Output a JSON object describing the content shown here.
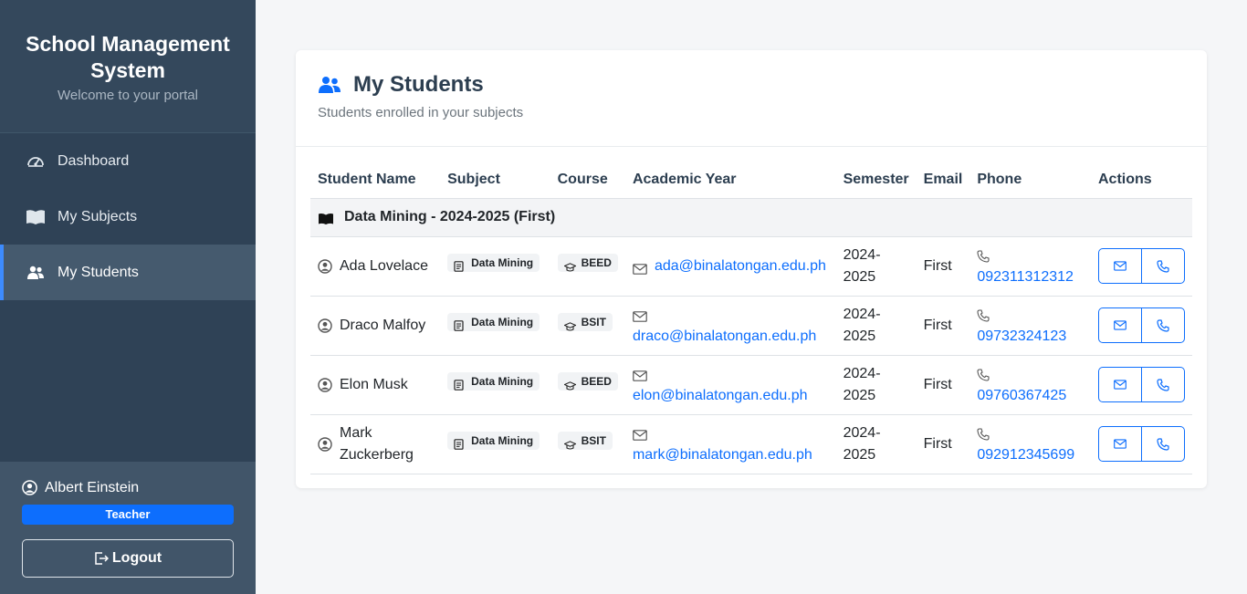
{
  "sidebar": {
    "title": "School Management System",
    "subtitle": "Welcome to your portal",
    "items": [
      {
        "label": "Dashboard",
        "icon": "speedometer-icon",
        "active": false
      },
      {
        "label": "My Subjects",
        "icon": "book-icon",
        "active": false
      },
      {
        "label": "My Students",
        "icon": "people-icon",
        "active": true
      }
    ],
    "user": {
      "name": "Albert Einstein",
      "role": "Teacher",
      "logout_label": "Logout"
    }
  },
  "main": {
    "title": "My Students",
    "subtitle": "Students enrolled in your subjects",
    "columns": [
      "Student Name",
      "Subject",
      "Course",
      "Academic Year",
      "Semester",
      "Email",
      "Phone",
      "Actions"
    ],
    "group_label": "Data Mining - 2024-2025 (First)",
    "rows": [
      {
        "name": "Ada Lovelace",
        "subject": "Data Mining",
        "course": "BEED",
        "email": "ada@binalatongan.edu.ph",
        "year": "2024-2025",
        "semester": "First",
        "phone": "092311312312"
      },
      {
        "name": "Draco Malfoy",
        "subject": "Data Mining",
        "course": "BSIT",
        "email": "draco@binalatongan.edu.ph",
        "year": "2024-2025",
        "semester": "First",
        "phone": "09732324123"
      },
      {
        "name": "Elon Musk",
        "subject": "Data Mining",
        "course": "BEED",
        "email": "elon@binalatongan.edu.ph",
        "year": "2024-2025",
        "semester": "First",
        "phone": "09760367425"
      },
      {
        "name": "Mark Zuckerberg",
        "subject": "Data Mining",
        "course": "BSIT",
        "email": "mark@binalatongan.edu.ph",
        "year": "2024-2025",
        "semester": "First",
        "phone": "092912345699"
      }
    ]
  },
  "colors": {
    "accent": "#0d6efd",
    "sidebar": "#2f4256"
  }
}
